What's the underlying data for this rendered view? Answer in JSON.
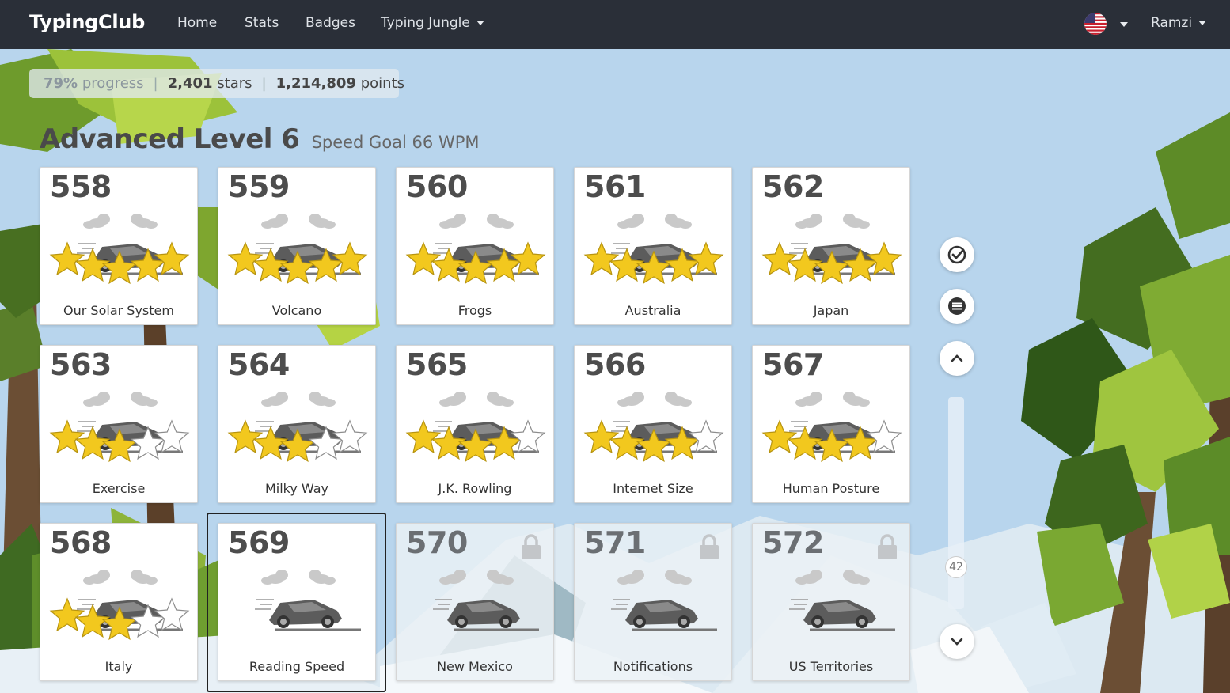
{
  "navbar": {
    "brand": "TypingClub",
    "links": [
      "Home",
      "Stats",
      "Badges",
      "Typing Jungle"
    ],
    "user": "Ramzi"
  },
  "stats": {
    "progress_value": "79%",
    "progress_label": "progress",
    "stars_value": "2,401",
    "stars_label": "stars",
    "points_value": "1,214,809",
    "points_label": "points"
  },
  "level": {
    "title": "Advanced Level 6",
    "speed_goal": "Speed Goal 66 WPM"
  },
  "lessons": [
    {
      "number": "558",
      "name": "Our Solar System",
      "stars": 5,
      "locked": false
    },
    {
      "number": "559",
      "name": "Volcano",
      "stars": 5,
      "locked": false
    },
    {
      "number": "560",
      "name": "Frogs",
      "stars": 5,
      "locked": false
    },
    {
      "number": "561",
      "name": "Australia",
      "stars": 5,
      "locked": false
    },
    {
      "number": "562",
      "name": "Japan",
      "stars": 5,
      "locked": false
    },
    {
      "number": "563",
      "name": "Exercise",
      "stars": 3,
      "locked": false
    },
    {
      "number": "564",
      "name": "Milky Way",
      "stars": 3,
      "locked": false
    },
    {
      "number": "565",
      "name": "J.K. Rowling",
      "stars": 4,
      "locked": false
    },
    {
      "number": "566",
      "name": "Internet Size",
      "stars": 4,
      "locked": false
    },
    {
      "number": "567",
      "name": "Human Posture",
      "stars": 4,
      "locked": false
    },
    {
      "number": "568",
      "name": "Italy",
      "stars": 3,
      "locked": false
    },
    {
      "number": "569",
      "name": "Reading Speed",
      "stars": 0,
      "locked": false,
      "selected": true
    },
    {
      "number": "570",
      "name": "New Mexico",
      "stars": 0,
      "locked": true
    },
    {
      "number": "571",
      "name": "Notifications",
      "stars": 0,
      "locked": true
    },
    {
      "number": "572",
      "name": "US Territories",
      "stars": 0,
      "locked": true
    }
  ],
  "side_controls": {
    "icons": [
      "check-circle-icon",
      "menu-icon",
      "chevron-up-icon",
      "chevron-down-icon"
    ],
    "scroll_value": "42"
  },
  "colors": {
    "navbar": "#2a2f38",
    "star_gold": "#f2c81e",
    "sky": "#b9d6ec"
  }
}
